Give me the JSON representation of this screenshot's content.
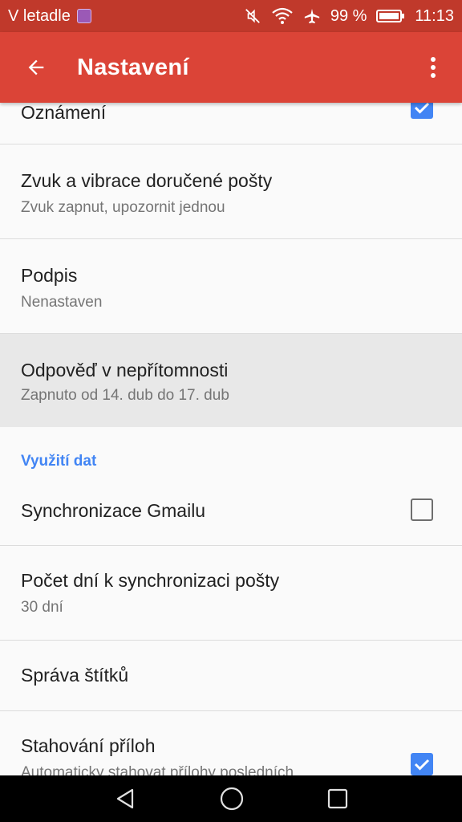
{
  "status_bar": {
    "carrier": "V letadle",
    "battery_percent": "99 %",
    "time": "11:13",
    "icons": [
      "gallery-notification-icon",
      "mute-icon",
      "wifi-icon",
      "airplane-icon",
      "battery-icon"
    ]
  },
  "app_bar": {
    "title": "Nastavení",
    "back_icon": "arrow-back-icon",
    "menu_icon": "more-vert-icon",
    "color": "#db4437"
  },
  "settings": {
    "notifications": {
      "title": "Oznámení",
      "checked": true
    },
    "sound": {
      "title": "Zvuk a vibrace doručené pošty",
      "subtitle": "Zvuk zapnut, upozornit jednou"
    },
    "signature": {
      "title": "Podpis",
      "subtitle": "Nenastaven"
    },
    "vacation": {
      "title": "Odpověď v nepřítomnosti",
      "subtitle": "Zapnuto od 14. dub do 17. dub"
    },
    "data_section": "Využití dat",
    "sync": {
      "title": "Synchronizace Gmailu",
      "checked": false
    },
    "sync_days": {
      "title": "Počet dní k synchronizaci pošty",
      "subtitle": "30 dní"
    },
    "labels": {
      "title": "Správa štítků"
    },
    "attachments": {
      "title": "Stahování příloh",
      "subtitle": "Automaticky stahovat přílohy posledních",
      "checked": true
    }
  },
  "nav_bar": {
    "icons": [
      "back-triangle-icon",
      "home-circle-icon",
      "recents-square-icon"
    ]
  },
  "colors": {
    "accent": "#4285f4",
    "status_bar": "#c0392b"
  }
}
